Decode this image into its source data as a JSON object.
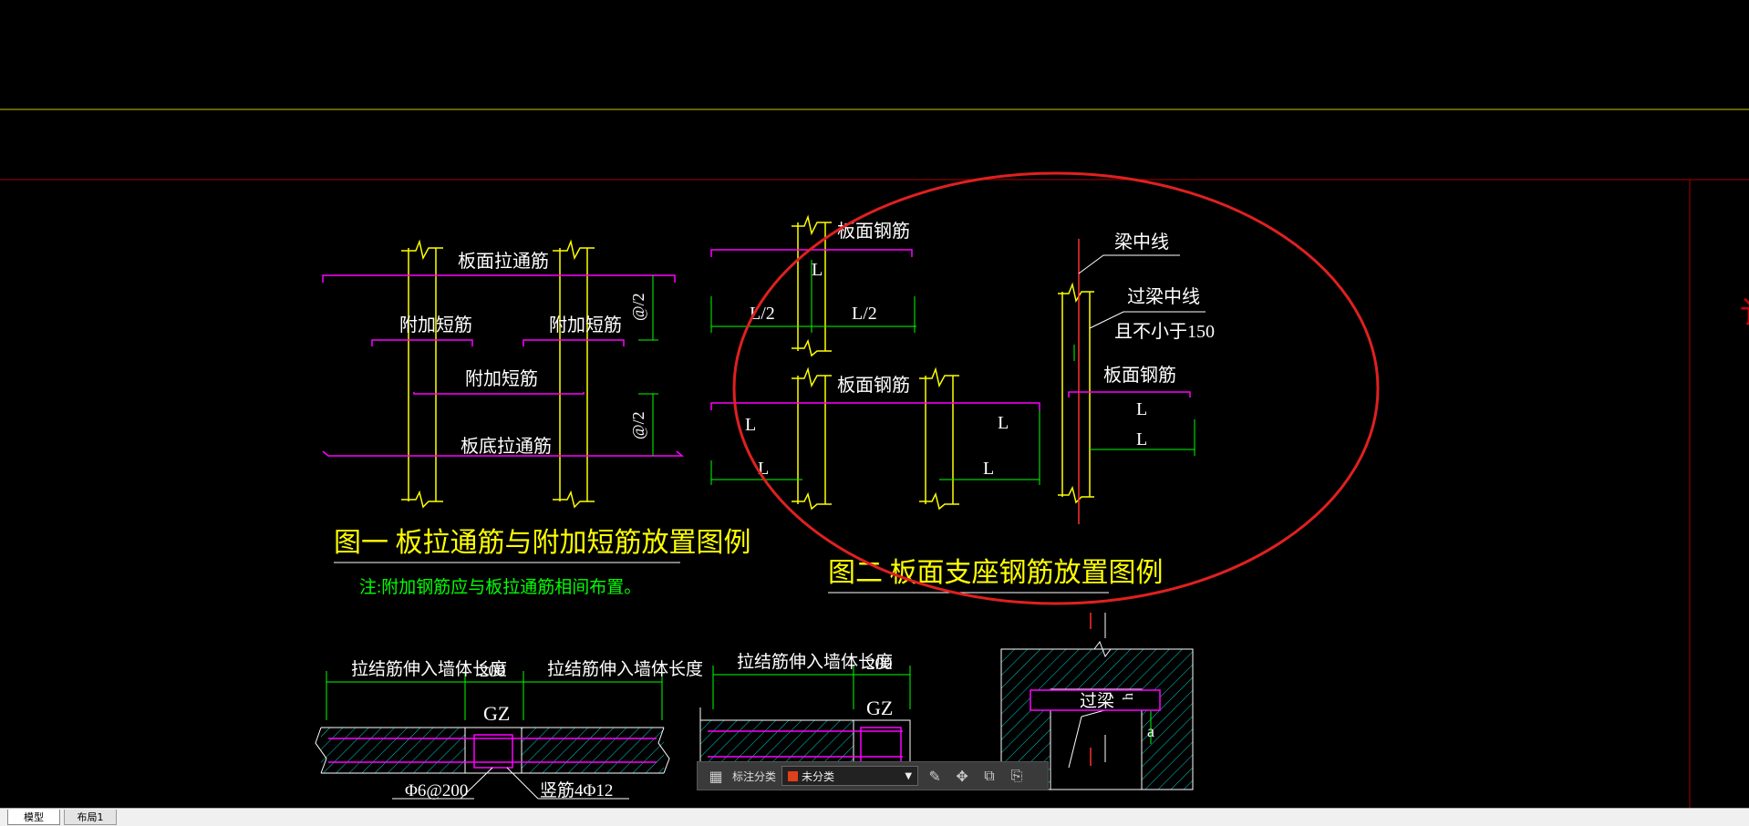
{
  "colors": {
    "background": "#000000",
    "rebar": "#ff00ff",
    "bar": "#ffff00",
    "dimension": "#00ff00",
    "text": "#ffffff",
    "title": "#ffff00",
    "note": "#00ff00",
    "red_line": "#cc0000",
    "highlight_circle": "#e02020",
    "hatch": "#00cccc"
  },
  "drawing": {
    "fig1": {
      "top_bar": "板面拉通筋",
      "left_short": "附加短筋",
      "right_short": "附加短筋",
      "mid_short": "附加短筋",
      "bottom_bar": "板底拉通筋",
      "dim_upper": "@/2",
      "dim_lower": "@/2",
      "title": "图一  板拉通筋与附加短筋放置图例",
      "note": "注:附加钢筋应与板拉通筋相间布置。"
    },
    "fig2": {
      "top_label": "板面钢筋",
      "top_L": "L",
      "left_half": "L/2",
      "right_half": "L/2",
      "mid_label": "板面钢筋",
      "mid_L_left": "L",
      "mid_L_bottom": "L",
      "mid_L_right": "L",
      "mid_L_right_bottom": "L",
      "beam_center": "梁中线",
      "over_beam_center": "过梁中线",
      "not_less": "且不小于150",
      "right_label": "板面钢筋",
      "right_L1": "L",
      "right_L2": "L",
      "title": "图二  板面支座钢筋放置图例"
    },
    "bottom": {
      "left_dim1": "拉结筋伸入墙体长度",
      "left_dim_mid": "200",
      "left_dim2": "拉结筋伸入墙体长度",
      "left_gz": "GZ",
      "left_rebar1": "Φ6@200",
      "left_rebar2": "竖筋4Φ12",
      "mid_dim1": "拉结筋伸入墙体长度",
      "mid_dim_mid": "200",
      "mid_gz": "GZ",
      "lintel": "过梁",
      "lintel_h": "h",
      "right_a": "a"
    }
  },
  "toolbar": {
    "category_label": "标注分类",
    "category_value": "未分类",
    "icons": [
      "layout-icon",
      "edit-icon",
      "move-icon",
      "copy-icon",
      "paste-icon"
    ]
  },
  "tabs": {
    "model": "模型",
    "layout1": "布局1"
  }
}
